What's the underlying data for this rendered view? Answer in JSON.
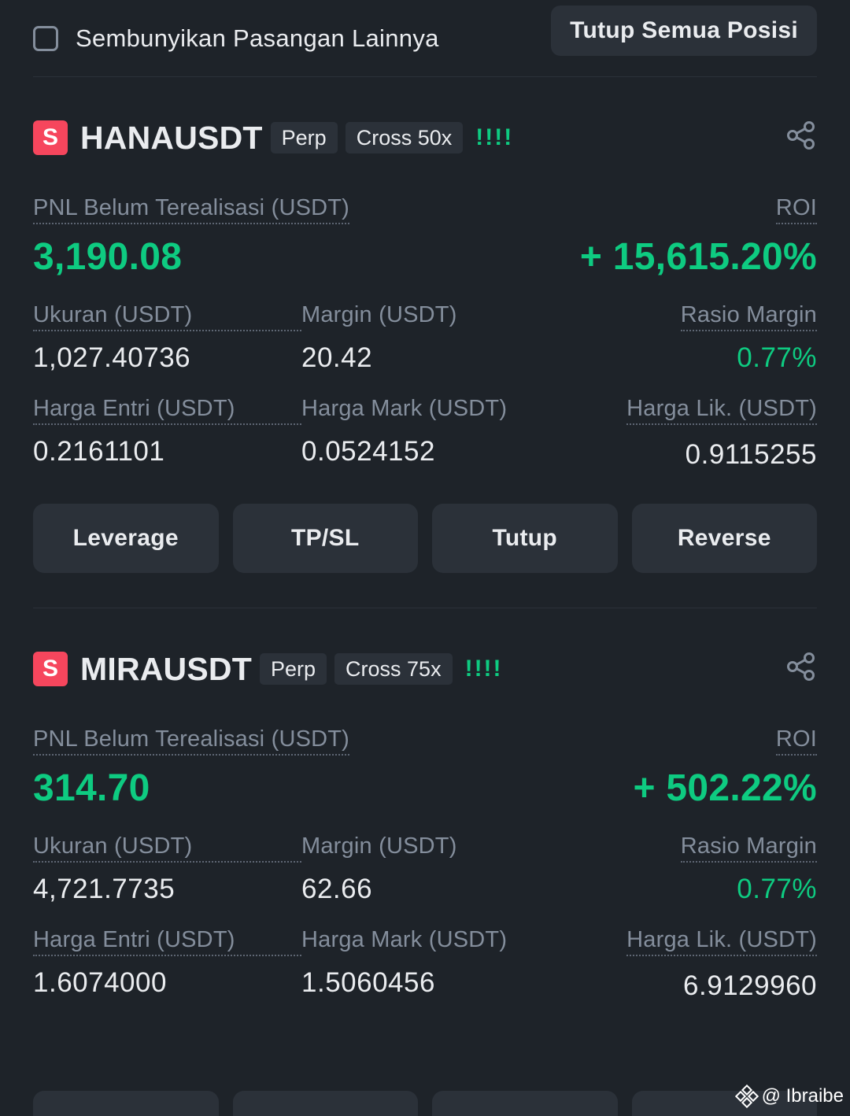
{
  "topbar": {
    "hide_label": "Sembunyikan Pasangan Lainnya",
    "close_all_label": "Tutup Semua Posisi"
  },
  "positions": [
    {
      "side_badge": "S",
      "symbol": "HANAUSDT",
      "type_tag": "Perp",
      "margin_tag": "Cross 50x",
      "signal": "!!!!",
      "pnl_label": "PNL Belum Terealisasi (USDT)",
      "pnl_value": "3,190.08",
      "roi_label": "ROI",
      "roi_value": "+ 15,615.20%",
      "size_label": "Ukuran (USDT)",
      "size_value": "1,027.40736",
      "margin_label": "Margin (USDT)",
      "margin_value": "20.42",
      "margin_ratio_label": "Rasio Margin",
      "margin_ratio_value": "0.77%",
      "entry_label": "Harga Entri (USDT)",
      "entry_value": "0.2161101",
      "mark_label": "Harga Mark (USDT)",
      "mark_value": "0.0524152",
      "liq_label": "Harga Lik. (USDT)",
      "liq_value": "0.9115255",
      "actions": [
        "Leverage",
        "TP/SL",
        "Tutup",
        "Reverse"
      ]
    },
    {
      "side_badge": "S",
      "symbol": "MIRAUSDT",
      "type_tag": "Perp",
      "margin_tag": "Cross 75x",
      "signal": "!!!!",
      "pnl_label": "PNL Belum Terealisasi (USDT)",
      "pnl_value": "314.70",
      "roi_label": "ROI",
      "roi_value": "+ 502.22%",
      "size_label": "Ukuran (USDT)",
      "size_value": "4,721.7735",
      "margin_label": "Margin (USDT)",
      "margin_value": "62.66",
      "margin_ratio_label": "Rasio Margin",
      "margin_ratio_value": "0.77%",
      "entry_label": "Harga Entri (USDT)",
      "entry_value": "1.6074000",
      "mark_label": "Harga Mark (USDT)",
      "mark_value": "1.5060456",
      "liq_label": "Harga Lik. (USDT)",
      "liq_value": "6.9129960"
    }
  ],
  "watermark": "@ Ibraibe",
  "colors": {
    "background": "#1e2329",
    "panel": "#2b3139",
    "profit_green": "#0ecb81",
    "short_red": "#f6465d",
    "muted_text": "#848e9c"
  }
}
